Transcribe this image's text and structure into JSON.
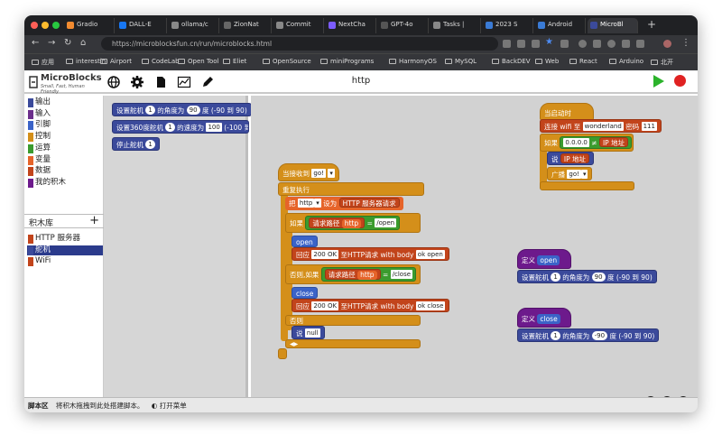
{
  "browser": {
    "tabs": [
      {
        "label": "Gradio",
        "color": "#f28b30"
      },
      {
        "label": "DALL-E",
        "color": "#1877f2"
      },
      {
        "label": "ollama/c",
        "color": "#888888"
      },
      {
        "label": "ZionNat",
        "color": "#666666"
      },
      {
        "label": "Commit",
        "color": "#888888"
      },
      {
        "label": "NextCha",
        "color": "#7c5cff"
      },
      {
        "label": "GPT-4o",
        "color": "#555555"
      },
      {
        "label": "Tasks |",
        "color": "#888888"
      },
      {
        "label": "2023 S",
        "color": "#3a7bd5"
      },
      {
        "label": "Android",
        "color": "#3a7bd5"
      },
      {
        "label": "MicroBl",
        "color": "#3b4a9b"
      }
    ],
    "url": "https://microblocksfun.cn/run/microblocks.html",
    "bookmarks": [
      "应用",
      "interestin",
      "Airport",
      "CodeLab",
      "Open Tool",
      "Eliet",
      "OpenSource",
      "miniPrograms",
      "HarmonyOS",
      "MySQL",
      "BackDEV",
      "Web",
      "React",
      "Arduino",
      "北开"
    ]
  },
  "app": {
    "logo_title": "MicroBlocks",
    "logo_tagline": "Small, Fast, Human Friendly",
    "project_title": "http",
    "toolbar_icons": [
      "globe-icon",
      "gear-icon",
      "file-icon",
      "graph-icon",
      "pen-icon"
    ],
    "categories": [
      {
        "label": "输出",
        "color": "#3b4a9b"
      },
      {
        "label": "输入",
        "color": "#6c2f8c"
      },
      {
        "label": "引脚",
        "color": "#3b63c8"
      },
      {
        "label": "控制",
        "color": "#d48f1a"
      },
      {
        "label": "运算",
        "color": "#3b9b2e"
      },
      {
        "label": "变量",
        "color": "#e6642a"
      },
      {
        "label": "数据",
        "color": "#c2441b"
      },
      {
        "label": "我的积木",
        "color": "#6d1a8c"
      }
    ],
    "library_header": "积木库",
    "library_add": "+",
    "libraries": [
      {
        "label": "HTTP 服务器",
        "color": "#c2441b",
        "selected": false
      },
      {
        "label": "舵机",
        "color": "#3b4a9b",
        "selected": true
      },
      {
        "label": "WiFi",
        "color": "#c2441b",
        "selected": false
      }
    ],
    "palette_blocks": {
      "b1_a": "设置舵机",
      "b1_n": "1",
      "b1_b": "的角度为",
      "b1_v": "90",
      "b1_c": "度 (-90 到 90)",
      "b2_a": "设置360度舵机",
      "b2_n": "1",
      "b2_b": "的速度为",
      "b2_v": "100",
      "b2_c": "(-100 到",
      "b3_a": "停止舵机",
      "b3_n": "1"
    },
    "script": {
      "when_recv": "当接收到",
      "when_msg": "go!",
      "repeat": "重复执行",
      "set_a": "把",
      "set_var": "http",
      "set_b": "设为",
      "set_c": "HTTP 服务器请求",
      "if1": "如果",
      "path1": "请求路径",
      "path1_var": "http",
      "eq1": "=",
      "path1_val": "/open",
      "open_lbl": "open",
      "resp1_a": "回应",
      "resp1_code": "200 OK",
      "resp1_b": "至HTTP请求 with body",
      "resp1_body": "ok open",
      "elif": "否则,如果",
      "path2": "请求路径",
      "path2_var": "http",
      "eq2": "=",
      "path2_val": "/close",
      "close_lbl": "close",
      "resp2_a": "回应",
      "resp2_code": "200 OK",
      "resp2_b": "至HTTP请求 with body",
      "resp2_body": "ok close",
      "else": "否则",
      "say": "说",
      "say_val": "null",
      "start_hat": "当启动时",
      "wifi_a": "连接 wifi 至",
      "wifi_ssid": "wonderland",
      "wifi_b": "密码",
      "wifi_pw": "111",
      "if2": "如果",
      "ip_val": "0.0.0.0",
      "ne": "≠",
      "ip_lbl": "IP 地址",
      "say2": "说",
      "ip_lbl2": "IP 地址",
      "bcast": "广播",
      "bcast_msg": "go!",
      "def1": "定义",
      "def1_name": "open",
      "def1_a": "设置舵机",
      "def1_n": "1",
      "def1_b": "的角度为",
      "def1_v": "90",
      "def1_c": "度 (-90 到 90)",
      "def2": "定义",
      "def2_name": "close",
      "def2_a": "设置舵机",
      "def2_n": "1",
      "def2_b": "的角度为",
      "def2_v": "-90",
      "def2_c": "度 (-90 到 90)"
    },
    "status_label": "脚本区",
    "status_hint": "将积木拖拽到此处搭建脚本。",
    "status_menu": "打开菜单"
  }
}
